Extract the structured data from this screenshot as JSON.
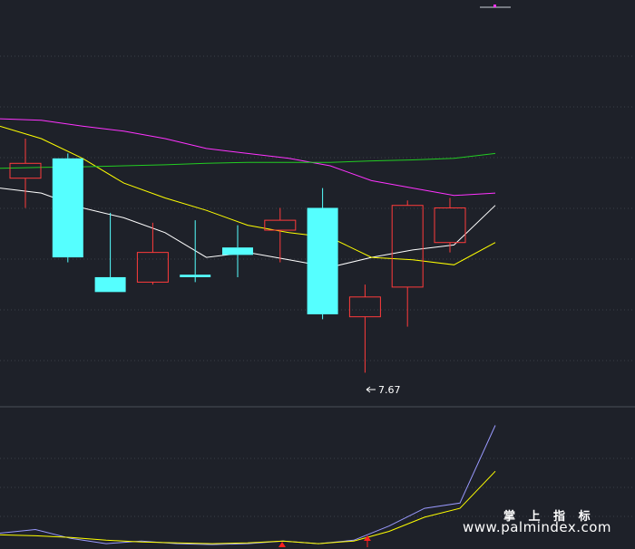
{
  "chart_data": {
    "type": "candlestick",
    "min_label": "7.67",
    "price_range": [
      7.0,
      15.2
    ],
    "candles": [
      {
        "open": 11.6,
        "close": 11.9,
        "high": 12.4,
        "low": 11.0,
        "color": "red"
      },
      {
        "open": 12.0,
        "close": 10.0,
        "high": 12.1,
        "low": 9.9,
        "color": "cyan"
      },
      {
        "open": 9.6,
        "close": 9.3,
        "high": 10.9,
        "low": 9.3,
        "color": "cyan"
      },
      {
        "open": 9.5,
        "close": 10.1,
        "high": 10.7,
        "low": 9.45,
        "color": "red"
      },
      {
        "open": 9.65,
        "close": 9.6,
        "high": 10.75,
        "low": 9.5,
        "color": "cyan"
      },
      {
        "open": 10.2,
        "close": 10.05,
        "high": 10.65,
        "low": 9.6,
        "color": "cyan"
      },
      {
        "open": 10.55,
        "close": 10.75,
        "high": 11.0,
        "low": 9.9,
        "color": "red"
      },
      {
        "open": 11.0,
        "close": 8.85,
        "high": 11.4,
        "low": 8.75,
        "color": "cyan"
      },
      {
        "open": 8.8,
        "close": 9.2,
        "high": 9.45,
        "low": 7.67,
        "color": "red"
      },
      {
        "open": 9.4,
        "close": 11.05,
        "high": 11.15,
        "low": 8.6,
        "color": "red"
      },
      {
        "open": 10.3,
        "close": 11.0,
        "high": 11.2,
        "low": 10.1,
        "color": "red"
      }
    ],
    "moving_averages": [
      {
        "color": "#ffffff",
        "values": [
          11.4,
          11.3,
          11.0,
          10.8,
          10.5,
          10.0,
          10.1,
          9.95,
          9.8,
          10.0,
          10.15,
          10.25,
          11.05
        ]
      },
      {
        "color": "#ffff00",
        "values": [
          12.65,
          12.4,
          12.0,
          11.5,
          11.2,
          10.95,
          10.65,
          10.5,
          10.4,
          10.0,
          9.95,
          9.85,
          10.3
        ]
      },
      {
        "color": "#ff33ff",
        "values": [
          12.8,
          12.77,
          12.65,
          12.55,
          12.4,
          12.2,
          12.1,
          12.0,
          11.85,
          11.55,
          11.4,
          11.25,
          11.3
        ]
      },
      {
        "color": "#22cc22",
        "values": [
          11.8,
          11.82,
          11.83,
          11.85,
          11.87,
          11.9,
          11.92,
          11.92,
          11.92,
          11.95,
          11.97,
          12.0,
          12.1
        ]
      }
    ],
    "indicator": {
      "range": [
        0,
        8
      ],
      "lines": [
        {
          "color": "#9a9aff",
          "values": [
            0.9,
            1.1,
            0.6,
            0.3,
            0.45,
            0.3,
            0.25,
            0.3,
            0.45,
            0.3,
            0.5,
            1.3,
            2.3,
            2.6,
            7.0
          ]
        },
        {
          "color": "#ffff00",
          "values": [
            0.8,
            0.75,
            0.65,
            0.5,
            0.4,
            0.35,
            0.3,
            0.35,
            0.45,
            0.3,
            0.45,
            1.0,
            1.8,
            2.3,
            4.4
          ]
        }
      ]
    }
  },
  "watermark": {
    "title": "掌 上 指 标",
    "url": "www.palmindex.com"
  }
}
